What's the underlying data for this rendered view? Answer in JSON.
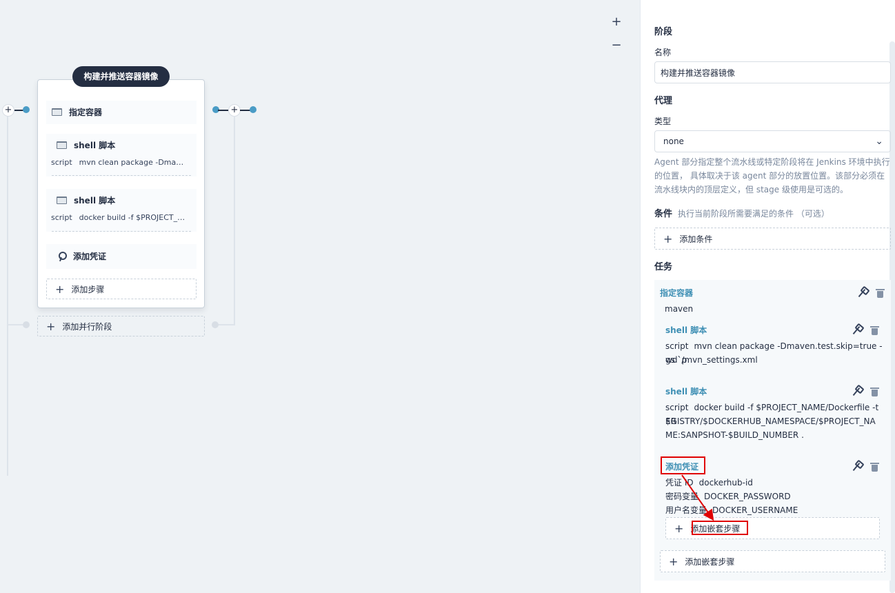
{
  "canvas": {
    "zoom_in": "+",
    "zoom_out": "−",
    "stage": {
      "name": "构建并推送容器镜像",
      "steps": [
        {
          "title": "指定容器",
          "icon": "terminal-icon"
        },
        {
          "title": "shell 脚本",
          "icon": "terminal-icon",
          "key": "script",
          "value": "mvn clean package -Dmaven.test.skip=true -gs `pwd`/mvn_settings.xml"
        },
        {
          "title": "shell 脚本",
          "icon": "terminal-icon",
          "key": "script",
          "value": "docker build -f $PROJECT_NAME/Dockerfile -t $REGISTRY/$DOCKERHUB_NAMESPACE/$PROJECT_NAME:SANPSHOT-$BUILD_NUMBER ."
        },
        {
          "title": "添加凭证",
          "icon": "key-icon"
        }
      ],
      "add_step": "添加步骤",
      "add_parallel_stage": "添加并行阶段"
    },
    "plus": "+"
  },
  "panel": {
    "stage_section": "阶段",
    "name_label": "名称",
    "name_value": "构建并推送容器镜像",
    "agent_section": "代理",
    "type_label": "类型",
    "type_value": "none",
    "agent_help": "Agent 部分指定整个流水线或特定阶段将在 Jenkins 环境中执行的位置， 具体取决于该 agent 部分的放置位置。该部分必须在流水线块内的顶层定义，但 stage 级使用是可选的。",
    "condition_section": "条件",
    "condition_hint": "执行当前阶段所需要满足的条件 （可选）",
    "add_condition": "添加条件",
    "task_section": "任务",
    "container": {
      "name": "指定容器",
      "value": "maven"
    },
    "shell1": {
      "name": "shell 脚本",
      "key": "script",
      "value": "mvn clean package -Dmaven.test.skip=true -gs `p",
      "value2": "wd`/mvn_settings.xml"
    },
    "shell2": {
      "name": "shell 脚本",
      "key": "script",
      "value": "docker build -f $PROJECT_NAME/Dockerfile -t $R",
      "value2": "EGISTRY/$DOCKERHUB_NAMESPACE/$PROJECT_NA",
      "value3": "ME:SANPSHOT-$BUILD_NUMBER ."
    },
    "credential": {
      "name": "添加凭证",
      "id_key": "凭证 ID",
      "id_value": "dockerhub-id",
      "pwd_key": "密码变量",
      "pwd_value": "DOCKER_PASSWORD",
      "user_key": "用户名变量",
      "user_value": "DOCKER_USERNAME",
      "add_nested": "添加嵌套步骤"
    },
    "add_nested_outer": "添加嵌套步骤",
    "plus": "+"
  },
  "colors": {
    "accent": "#3e8fb4",
    "highlight": "#e00000",
    "dark": "#242e42"
  }
}
